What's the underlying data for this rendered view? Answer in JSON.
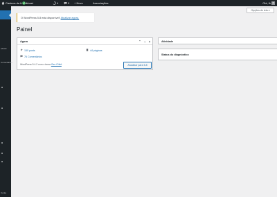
{
  "adminbar": {
    "site_name": "Casinos da Linda",
    "plugin_label": "Yoast",
    "updates_count": "4",
    "comments_count": "0",
    "new_label": "+ Novo",
    "assoc_label": "Associações",
    "user_greeting": "Olá, flr"
  },
  "sidebar": {
    "labels": [
      "eduart",
      "Comentários",
      "Conta"
    ]
  },
  "screen_options": {
    "label": "Opções de tela"
  },
  "notice": {
    "text": "O WordPress 5.8 está disponível!",
    "link": "Atualizar agora."
  },
  "page": {
    "title": "Painel"
  },
  "glance": {
    "title": "Agora",
    "posts": "150 posts",
    "pages": "44 páginas",
    "comments": "76 Comentários",
    "footer_text": "WordPress 5.4.2 com o tema",
    "theme_link": "Geo Child",
    "update_button": "Atualizar para 5.8"
  },
  "activity": {
    "title": "Atividade"
  },
  "health": {
    "title": "Status do diagnóstico"
  },
  "colors": {
    "adminbar": "#1d2327",
    "accent": "#2271b1",
    "notice_border": "#dba617",
    "background": "#f0f0f1"
  }
}
